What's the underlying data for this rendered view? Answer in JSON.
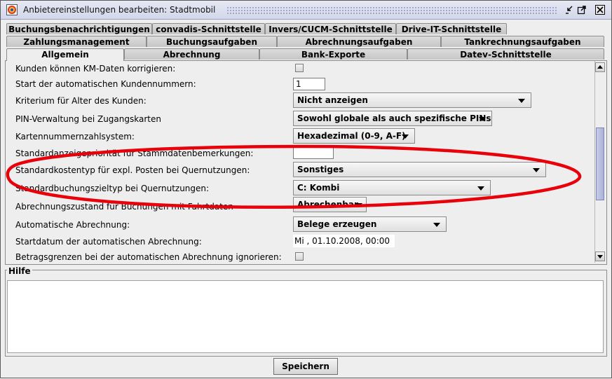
{
  "window": {
    "title": "Anbietereinstellungen bearbeiten: Stadtmobil"
  },
  "tabs": {
    "row1": [
      "Buchungsbenachrichtigungen",
      "convadis-Schnittstelle",
      "Invers/CUCM-Schnittstelle",
      "Drive-IT-Schnittstelle"
    ],
    "row2": [
      "Zahlungsmanagement",
      "Buchungsaufgaben",
      "Abrechnungsaufgaben",
      "Tankrechnungsaufgaben"
    ],
    "row3": [
      "Allgemein",
      "Abrechnung",
      "Bank-Exporte",
      "Datev-Schnittstelle"
    ],
    "selected": "Allgemein"
  },
  "settings": [
    {
      "label": "Kunden können KM-Daten korrigieren:",
      "control": "checkbox",
      "checked": false
    },
    {
      "label": "Start der automatischen Kundennummern:",
      "control": "text",
      "value": "1"
    },
    {
      "label": "Kriterium für Alter des Kunden:",
      "control": "combo",
      "value": "Nicht anzeigen"
    },
    {
      "label": "PIN-Verwaltung bei Zugangskarten",
      "control": "combo",
      "value": "Sowohl globale als auch spezifische PINs"
    },
    {
      "label": "Kartennummernzahlsystem:",
      "control": "combo",
      "value": "Hexadezimal (0-9, A-F)"
    },
    {
      "label": "Standardanzeigepriorität für Stammdatenbemerkungen:",
      "control": "text",
      "value": ""
    },
    {
      "label": "Standardkostentyp für expl. Posten bei Quernutzungen:",
      "control": "combo",
      "value": "Sonstiges"
    },
    {
      "label": "Standardbuchungszieltyp bei Quernutzungen:",
      "control": "combo",
      "value": "C: Kombi"
    },
    {
      "label": "Abrechnungszustand für Buchungen mit Fahrtdaten",
      "control": "combo",
      "value": "Abrechenbar"
    },
    {
      "label": "Automatische Abrechnung:",
      "control": "combo",
      "value": "Belege erzeugen"
    },
    {
      "label": "Startdatum der automatischen Abrechnung:",
      "control": "date",
      "value": "Mi , 01.10.2008, 00:00"
    },
    {
      "label": "Betragsgrenzen bei der automatischen Abrechnung ignorieren:",
      "control": "checkbox",
      "checked": false
    }
  ],
  "help": {
    "title": "Hilfe",
    "text": ""
  },
  "buttons": {
    "save": "Speichern"
  },
  "annotation": {
    "color": "#e8000a"
  },
  "icons": {
    "app": "app-logo-icon",
    "minimize": "minimize-icon",
    "maximize": "maximize-icon",
    "close": "close-icon"
  }
}
